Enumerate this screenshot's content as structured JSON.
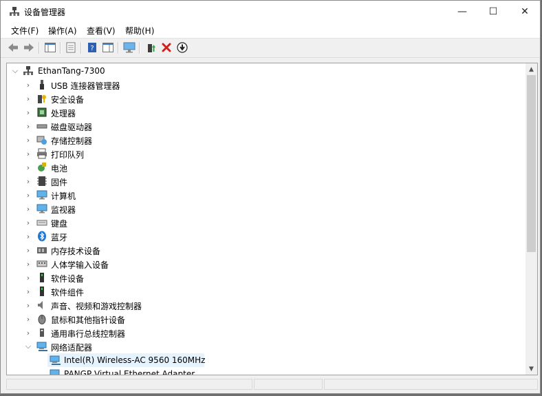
{
  "window": {
    "title": "设备管理器"
  },
  "window_controls": {
    "minimize": "—",
    "maximize": "☐",
    "close": "✕"
  },
  "menu": [
    "文件(F)",
    "操作(A)",
    "查看(V)",
    "帮助(H)"
  ],
  "tree": {
    "root": "EthanTang-7300",
    "categories": [
      "USB 连接器管理器",
      "安全设备",
      "处理器",
      "磁盘驱动器",
      "存储控制器",
      "打印队列",
      "电池",
      "固件",
      "计算机",
      "监视器",
      "键盘",
      "蓝牙",
      "内存技术设备",
      "人体学输入设备",
      "软件设备",
      "软件组件",
      "声音、视频和游戏控制器",
      "鼠标和其他指针设备",
      "通用串行总线控制器",
      "网络适配器"
    ],
    "network_children": [
      "Intel(R) Wireless-AC 9560 160MHz",
      "PANGP Virtual Ethernet Adapter"
    ]
  },
  "colors": {
    "selection": "#e5f3ff",
    "accent": "#1e90ff"
  }
}
